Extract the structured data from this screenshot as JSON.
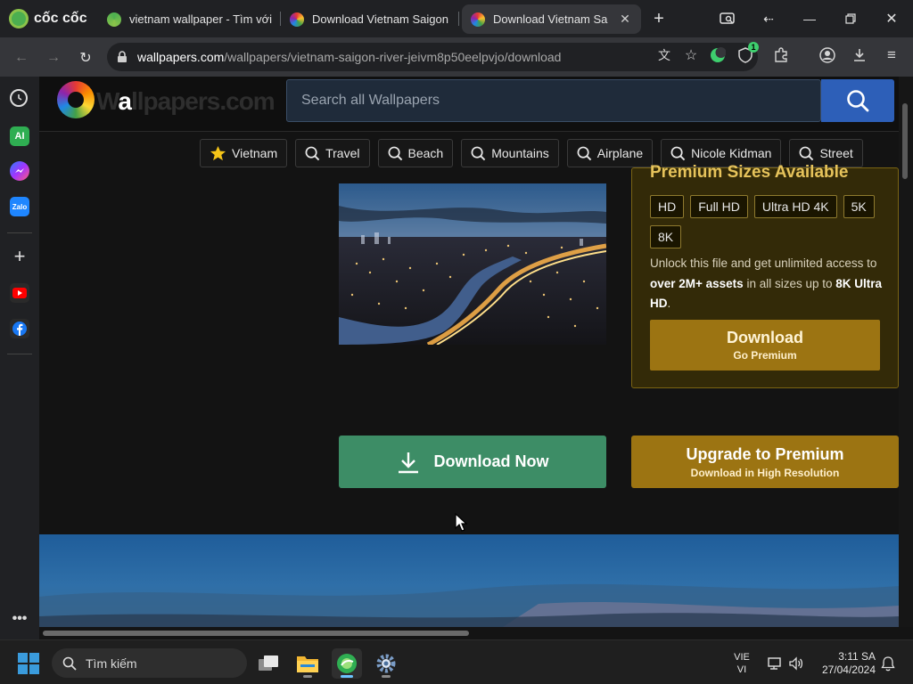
{
  "browser": {
    "brand": "cốc cốc",
    "tabs": [
      {
        "title": "vietnam wallpaper - Tìm với",
        "active": false
      },
      {
        "title": "Download Vietnam Saigon",
        "active": false
      },
      {
        "title": "Download Vietnam Sa",
        "active": true
      }
    ],
    "url": {
      "host": "wallpapers.com",
      "path": "/wallpapers/vietnam-saigon-river-jeivm8p50eelpvjo/download"
    },
    "extension_badge": "1"
  },
  "side_panel": {
    "items": [
      "history-icon",
      "ai-icon",
      "messenger-icon",
      "zalo-icon",
      "add-icon",
      "youtube-icon",
      "facebook-icon",
      "more-icon"
    ],
    "ai_label": "AI",
    "zalo_label": "Zalo"
  },
  "site": {
    "logo_text_pre": "W",
    "logo_text_hi": "a",
    "logo_text_post": "llpapers.com",
    "search_placeholder": "Search all Wallpapers",
    "tags": [
      {
        "label": "Vietnam",
        "icon": "star-icon"
      },
      {
        "label": "Travel",
        "icon": "search-icon"
      },
      {
        "label": "Beach",
        "icon": "search-icon"
      },
      {
        "label": "Mountains",
        "icon": "search-icon"
      },
      {
        "label": "Airplane",
        "icon": "search-icon"
      },
      {
        "label": "Nicole Kidman",
        "icon": "search-icon"
      },
      {
        "label": "Street",
        "icon": "search-icon"
      }
    ],
    "premium": {
      "heading": "Premium Sizes Available",
      "sizes": [
        "HD",
        "Full HD",
        "Ultra HD 4K",
        "5K",
        "8K"
      ],
      "text_1": "Unlock this file and get unlimited access to ",
      "text_bold_1": "over 2M+ assets",
      "text_2": " in all sizes up to ",
      "text_bold_2": "8K Ultra HD",
      "text_3": ".",
      "download_label": "Download",
      "download_sub": "Go Premium"
    },
    "download_now_label": "Download Now",
    "upgrade_label": "Upgrade to Premium",
    "upgrade_sub": "Download in High Resolution"
  },
  "taskbar": {
    "search_placeholder": "Tìm kiếm",
    "apps": [
      "task-view-icon",
      "file-explorer-icon",
      "coccoc-browser-icon",
      "settings-icon"
    ],
    "lang_1": "VIE",
    "lang_2": "VI",
    "time": "3:11 SA",
    "date": "27/04/2024"
  },
  "colors": {
    "download_green": "#3d8d66",
    "premium_gold": "#9c7412",
    "search_blue": "#2d5fb8"
  }
}
